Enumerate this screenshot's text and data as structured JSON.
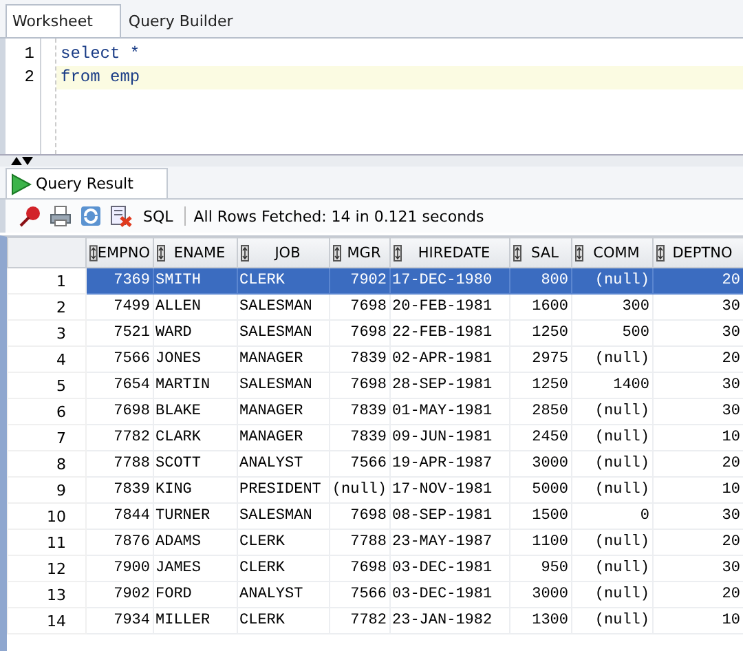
{
  "editor_tabs": [
    {
      "label": "Worksheet",
      "selected": true
    },
    {
      "label": "Query Builder",
      "selected": false
    }
  ],
  "editor": {
    "lines": [
      {
        "number": "1",
        "code": "select *",
        "current": false
      },
      {
        "number": "2",
        "code": "from emp",
        "current": true
      }
    ]
  },
  "result_tab": {
    "label": "Query Result",
    "selected": true
  },
  "toolbar": {
    "sql_label": "SQL",
    "status": "All Rows Fetched: 14 in 0.121 seconds"
  },
  "table": {
    "columns": [
      {
        "label": "EMPNO"
      },
      {
        "label": "ENAME"
      },
      {
        "label": "JOB"
      },
      {
        "label": "MGR"
      },
      {
        "label": "HIREDATE"
      },
      {
        "label": "SAL"
      },
      {
        "label": "COMM"
      },
      {
        "label": "DEPTNO"
      }
    ],
    "rows": [
      {
        "number": "1",
        "selected": true,
        "cells": [
          "7369",
          "SMITH",
          "CLERK",
          "7902",
          "17-DEC-1980",
          "800",
          "(null)",
          "20"
        ]
      },
      {
        "number": "2",
        "selected": false,
        "cells": [
          "7499",
          "ALLEN",
          "SALESMAN",
          "7698",
          "20-FEB-1981",
          "1600",
          "300",
          "30"
        ]
      },
      {
        "number": "3",
        "selected": false,
        "cells": [
          "7521",
          "WARD",
          "SALESMAN",
          "7698",
          "22-FEB-1981",
          "1250",
          "500",
          "30"
        ]
      },
      {
        "number": "4",
        "selected": false,
        "cells": [
          "7566",
          "JONES",
          "MANAGER",
          "7839",
          "02-APR-1981",
          "2975",
          "(null)",
          "20"
        ]
      },
      {
        "number": "5",
        "selected": false,
        "cells": [
          "7654",
          "MARTIN",
          "SALESMAN",
          "7698",
          "28-SEP-1981",
          "1250",
          "1400",
          "30"
        ]
      },
      {
        "number": "6",
        "selected": false,
        "cells": [
          "7698",
          "BLAKE",
          "MANAGER",
          "7839",
          "01-MAY-1981",
          "2850",
          "(null)",
          "30"
        ]
      },
      {
        "number": "7",
        "selected": false,
        "cells": [
          "7782",
          "CLARK",
          "MANAGER",
          "7839",
          "09-JUN-1981",
          "2450",
          "(null)",
          "10"
        ]
      },
      {
        "number": "8",
        "selected": false,
        "cells": [
          "7788",
          "SCOTT",
          "ANALYST",
          "7566",
          "19-APR-1987",
          "3000",
          "(null)",
          "20"
        ]
      },
      {
        "number": "9",
        "selected": false,
        "cells": [
          "7839",
          "KING",
          "PRESIDENT",
          "(null)",
          "17-NOV-1981",
          "5000",
          "(null)",
          "10"
        ]
      },
      {
        "number": "10",
        "selected": false,
        "cells": [
          "7844",
          "TURNER",
          "SALESMAN",
          "7698",
          "08-SEP-1981",
          "1500",
          "0",
          "30"
        ]
      },
      {
        "number": "11",
        "selected": false,
        "cells": [
          "7876",
          "ADAMS",
          "CLERK",
          "7788",
          "23-MAY-1987",
          "1100",
          "(null)",
          "20"
        ]
      },
      {
        "number": "12",
        "selected": false,
        "cells": [
          "7900",
          "JAMES",
          "CLERK",
          "7698",
          "03-DEC-1981",
          "950",
          "(null)",
          "30"
        ]
      },
      {
        "number": "13",
        "selected": false,
        "cells": [
          "7902",
          "FORD",
          "ANALYST",
          "7566",
          "03-DEC-1981",
          "3000",
          "(null)",
          "20"
        ]
      },
      {
        "number": "14",
        "selected": false,
        "cells": [
          "7934",
          "MILLER",
          "CLERK",
          "7782",
          "23-JAN-1982",
          "1300",
          "(null)",
          "10"
        ]
      }
    ]
  }
}
